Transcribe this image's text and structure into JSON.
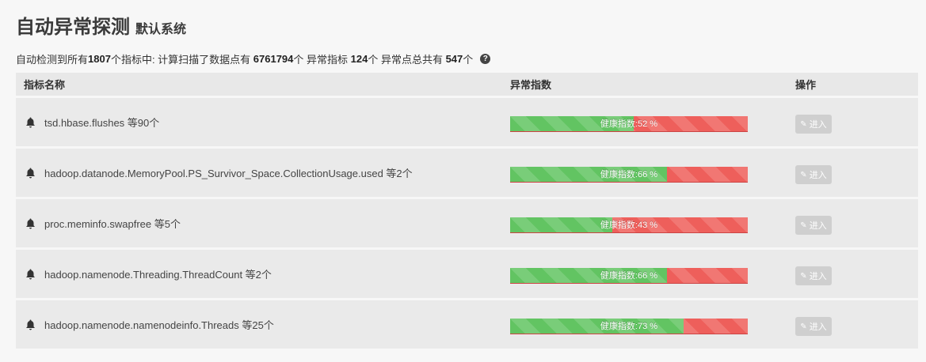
{
  "header": {
    "title": "自动异常探测",
    "subtitle": "默认系统"
  },
  "summary": {
    "prefix": "自动检测到所有",
    "total_metrics": "1807",
    "mid1": "个指标中: 计算扫描了数据点有 ",
    "data_points": "6761794",
    "mid2": "个 异常指标 ",
    "anomaly_metrics": "124",
    "mid3": "个 异常点总共有 ",
    "anomaly_points": "547",
    "suffix": "个",
    "help_icon": "question-circle-icon"
  },
  "table": {
    "columns": {
      "name": "指标名称",
      "score": "异常指数",
      "action": "操作"
    },
    "rows": [
      {
        "metric": "tsd.hbase.flushes 等90个",
        "health_label": "健康指数:52 %",
        "health": 52,
        "action_label": "进入"
      },
      {
        "metric": "hadoop.datanode.MemoryPool.PS_Survivor_Space.CollectionUsage.used 等2个",
        "health_label": "健康指数:66 %",
        "health": 66,
        "action_label": "进入"
      },
      {
        "metric": "proc.meminfo.swapfree 等5个",
        "health_label": "健康指数:43 %",
        "health": 43,
        "action_label": "进入"
      },
      {
        "metric": "hadoop.namenode.Threading.ThreadCount 等2个",
        "health_label": "健康指数:66 %",
        "health": 66,
        "action_label": "进入"
      },
      {
        "metric": "hadoop.namenode.namenodeinfo.Threads 等25个",
        "health_label": "健康指数:73 %",
        "health": 73,
        "action_label": "进入"
      }
    ]
  },
  "colors": {
    "healthy": "#62c462",
    "unhealthy": "#ee5f5b",
    "button": "#cfcfcf"
  },
  "icons": {
    "row_icon": "bell-icon",
    "button_icon": "edit-icon"
  }
}
